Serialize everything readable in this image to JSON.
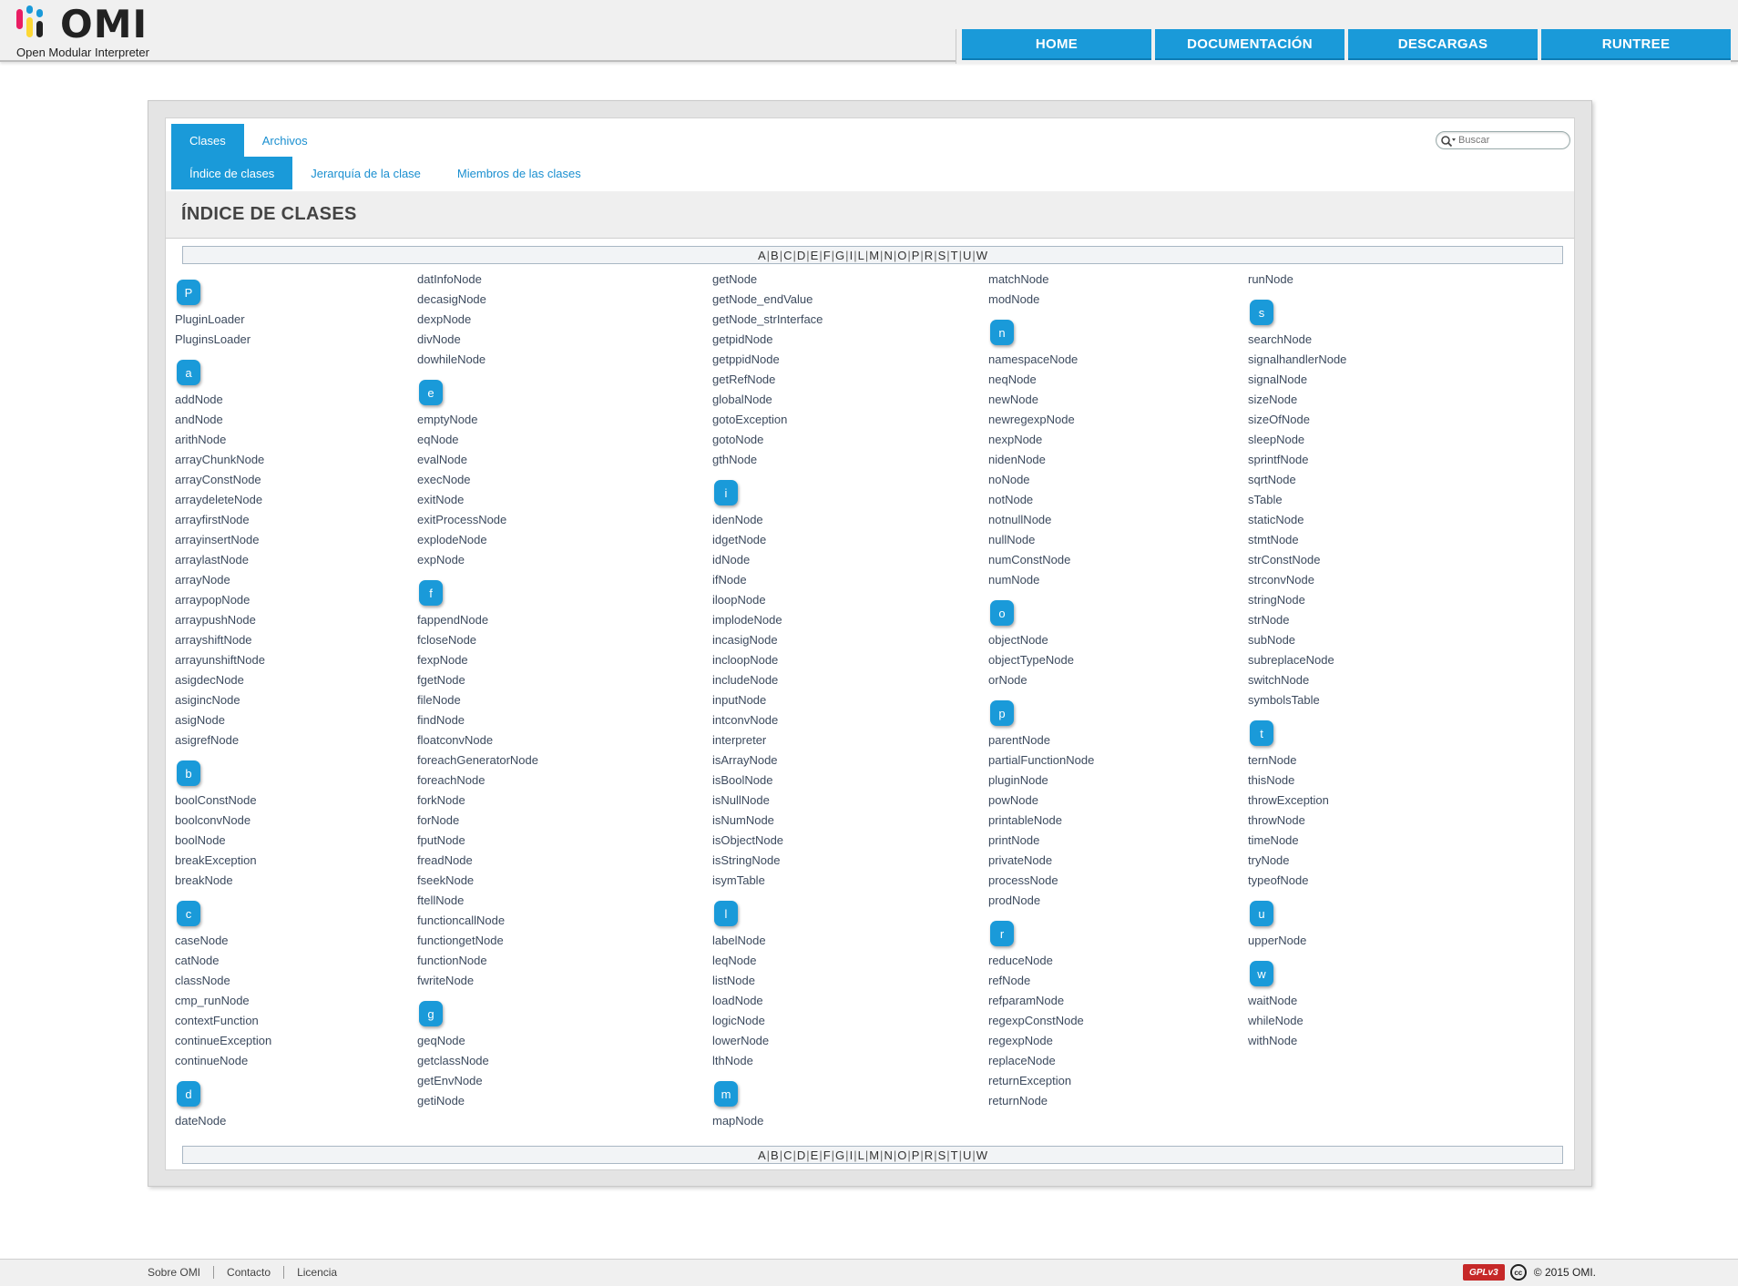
{
  "header": {
    "logo_text": "OMI",
    "logo_subtitle": "Open Modular Interpreter",
    "logo_colors": [
      "#e91e63",
      "#1a9ad9",
      "#fdd835",
      "#222222"
    ],
    "nav": [
      "HOME",
      "DOCUMENTACIÓN",
      "DESCARGAS",
      "RUNTREE"
    ],
    "accent": "#1a9ad9"
  },
  "tabs": {
    "primary": [
      "Clases",
      "Archivos"
    ],
    "secondary": [
      "Índice de clases",
      "Jerarquía de la clase",
      "Miembros de las clases"
    ]
  },
  "search": {
    "placeholder": "Buscar"
  },
  "page_title": "ÍNDICE DE CLASES",
  "alphabet": [
    "A",
    "B",
    "C",
    "D",
    "E",
    "F",
    "G",
    "I",
    "L",
    "M",
    "N",
    "O",
    "P",
    "R",
    "S",
    "T",
    "U",
    "W"
  ],
  "columns": [
    [
      {
        "letter": "P"
      },
      {
        "name": "PluginLoader"
      },
      {
        "name": "PluginsLoader"
      },
      {
        "letter": "a"
      },
      {
        "name": "addNode"
      },
      {
        "name": "andNode"
      },
      {
        "name": "arithNode"
      },
      {
        "name": "arrayChunkNode"
      },
      {
        "name": "arrayConstNode"
      },
      {
        "name": "arraydeleteNode"
      },
      {
        "name": "arrayfirstNode"
      },
      {
        "name": "arrayinsertNode"
      },
      {
        "name": "arraylastNode"
      },
      {
        "name": "arrayNode"
      },
      {
        "name": "arraypopNode"
      },
      {
        "name": "arraypushNode"
      },
      {
        "name": "arrayshiftNode"
      },
      {
        "name": "arrayunshiftNode"
      },
      {
        "name": "asigdecNode"
      },
      {
        "name": "asigincNode"
      },
      {
        "name": "asigNode"
      },
      {
        "name": "asigrefNode"
      },
      {
        "letter": "b"
      },
      {
        "name": "boolConstNode"
      },
      {
        "name": "boolconvNode"
      },
      {
        "name": "boolNode"
      },
      {
        "name": "breakException"
      },
      {
        "name": "breakNode"
      },
      {
        "letter": "c"
      },
      {
        "name": "caseNode"
      },
      {
        "name": "catNode"
      },
      {
        "name": "classNode"
      },
      {
        "name": "cmp_runNode"
      },
      {
        "name": "contextFunction"
      },
      {
        "name": "continueException"
      },
      {
        "name": "continueNode"
      },
      {
        "letter": "d"
      },
      {
        "name": "dateNode"
      }
    ],
    [
      {
        "name": "datInfoNode"
      },
      {
        "name": "decasigNode"
      },
      {
        "name": "dexpNode"
      },
      {
        "name": "divNode"
      },
      {
        "name": "dowhileNode"
      },
      {
        "letter": "e"
      },
      {
        "name": "emptyNode"
      },
      {
        "name": "eqNode"
      },
      {
        "name": "evalNode"
      },
      {
        "name": "execNode"
      },
      {
        "name": "exitNode"
      },
      {
        "name": "exitProcessNode"
      },
      {
        "name": "explodeNode"
      },
      {
        "name": "expNode"
      },
      {
        "letter": "f"
      },
      {
        "name": "fappendNode"
      },
      {
        "name": "fcloseNode"
      },
      {
        "name": "fexpNode"
      },
      {
        "name": "fgetNode"
      },
      {
        "name": "fileNode"
      },
      {
        "name": "findNode"
      },
      {
        "name": "floatconvNode"
      },
      {
        "name": "foreachGeneratorNode"
      },
      {
        "name": "foreachNode"
      },
      {
        "name": "forkNode"
      },
      {
        "name": "forNode"
      },
      {
        "name": "fputNode"
      },
      {
        "name": "freadNode"
      },
      {
        "name": "fseekNode"
      },
      {
        "name": "ftellNode"
      },
      {
        "name": "functioncallNode"
      },
      {
        "name": "functiongetNode"
      },
      {
        "name": "functionNode"
      },
      {
        "name": "fwriteNode"
      },
      {
        "letter": "g"
      },
      {
        "name": "geqNode"
      },
      {
        "name": "getclassNode"
      },
      {
        "name": "getEnvNode"
      },
      {
        "name": "getiNode"
      }
    ],
    [
      {
        "name": "getNode"
      },
      {
        "name": "getNode_endValue"
      },
      {
        "name": "getNode_strInterface"
      },
      {
        "name": "getpidNode"
      },
      {
        "name": "getppidNode"
      },
      {
        "name": "getRefNode"
      },
      {
        "name": "globalNode"
      },
      {
        "name": "gotoException"
      },
      {
        "name": "gotoNode"
      },
      {
        "name": "gthNode"
      },
      {
        "letter": "i"
      },
      {
        "name": "idenNode"
      },
      {
        "name": "idgetNode"
      },
      {
        "name": "idNode"
      },
      {
        "name": "ifNode"
      },
      {
        "name": "iloopNode"
      },
      {
        "name": "implodeNode"
      },
      {
        "name": "incasigNode"
      },
      {
        "name": "incloopNode"
      },
      {
        "name": "includeNode"
      },
      {
        "name": "inputNode"
      },
      {
        "name": "intconvNode"
      },
      {
        "name": "interpreter"
      },
      {
        "name": "isArrayNode"
      },
      {
        "name": "isBoolNode"
      },
      {
        "name": "isNullNode"
      },
      {
        "name": "isNumNode"
      },
      {
        "name": "isObjectNode"
      },
      {
        "name": "isStringNode"
      },
      {
        "name": "isymTable"
      },
      {
        "letter": "l"
      },
      {
        "name": "labelNode"
      },
      {
        "name": "leqNode"
      },
      {
        "name": "listNode"
      },
      {
        "name": "loadNode"
      },
      {
        "name": "logicNode"
      },
      {
        "name": "lowerNode"
      },
      {
        "name": "lthNode"
      },
      {
        "letter": "m"
      },
      {
        "name": "mapNode"
      }
    ],
    [
      {
        "name": "matchNode"
      },
      {
        "name": "modNode"
      },
      {
        "letter": "n"
      },
      {
        "name": "namespaceNode"
      },
      {
        "name": "neqNode"
      },
      {
        "name": "newNode"
      },
      {
        "name": "newregexpNode"
      },
      {
        "name": "nexpNode"
      },
      {
        "name": "nidenNode"
      },
      {
        "name": "noNode"
      },
      {
        "name": "notNode"
      },
      {
        "name": "notnullNode"
      },
      {
        "name": "nullNode"
      },
      {
        "name": "numConstNode"
      },
      {
        "name": "numNode"
      },
      {
        "letter": "o"
      },
      {
        "name": "objectNode"
      },
      {
        "name": "objectTypeNode"
      },
      {
        "name": "orNode"
      },
      {
        "letter": "p"
      },
      {
        "name": "parentNode"
      },
      {
        "name": "partialFunctionNode"
      },
      {
        "name": "pluginNode"
      },
      {
        "name": "powNode"
      },
      {
        "name": "printableNode"
      },
      {
        "name": "printNode"
      },
      {
        "name": "privateNode"
      },
      {
        "name": "processNode"
      },
      {
        "name": "prodNode"
      },
      {
        "letter": "r"
      },
      {
        "name": "reduceNode"
      },
      {
        "name": "refNode"
      },
      {
        "name": "refparamNode"
      },
      {
        "name": "regexpConstNode"
      },
      {
        "name": "regexpNode"
      },
      {
        "name": "replaceNode"
      },
      {
        "name": "returnException"
      },
      {
        "name": "returnNode"
      }
    ],
    [
      {
        "name": "runNode"
      },
      {
        "letter": "s"
      },
      {
        "name": "searchNode"
      },
      {
        "name": "signalhandlerNode"
      },
      {
        "name": "signalNode"
      },
      {
        "name": "sizeNode"
      },
      {
        "name": "sizeOfNode"
      },
      {
        "name": "sleepNode"
      },
      {
        "name": "sprintfNode"
      },
      {
        "name": "sqrtNode"
      },
      {
        "name": "sTable"
      },
      {
        "name": "staticNode"
      },
      {
        "name": "stmtNode"
      },
      {
        "name": "strConstNode"
      },
      {
        "name": "strconvNode"
      },
      {
        "name": "stringNode"
      },
      {
        "name": "strNode"
      },
      {
        "name": "subNode"
      },
      {
        "name": "subreplaceNode"
      },
      {
        "name": "switchNode"
      },
      {
        "name": "symbolsTable"
      },
      {
        "letter": "t"
      },
      {
        "name": "ternNode"
      },
      {
        "name": "thisNode"
      },
      {
        "name": "throwException"
      },
      {
        "name": "throwNode"
      },
      {
        "name": "timeNode"
      },
      {
        "name": "tryNode"
      },
      {
        "name": "typeofNode"
      },
      {
        "letter": "u"
      },
      {
        "name": "upperNode"
      },
      {
        "letter": "w"
      },
      {
        "name": "waitNode"
      },
      {
        "name": "whileNode"
      },
      {
        "name": "withNode"
      }
    ]
  ],
  "footer": {
    "links": [
      "Sobre OMI",
      "Contacto",
      "Licencia"
    ],
    "license_badge": "GPLv3",
    "cc_label": "cc",
    "copyright": "© 2015 OMI."
  }
}
